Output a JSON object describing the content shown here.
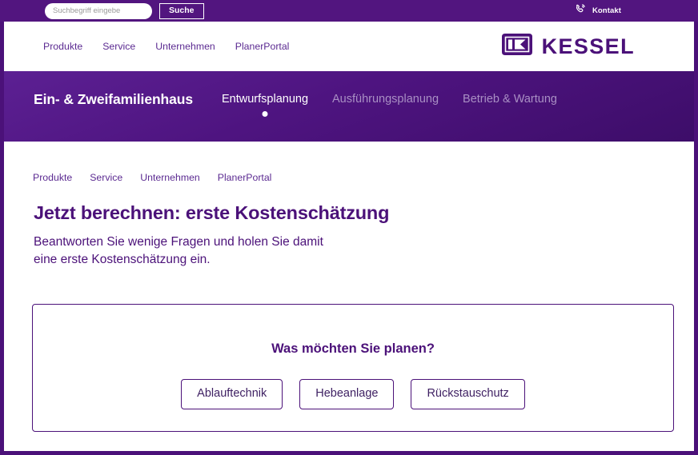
{
  "colors": {
    "brand_purple": "#4b1179",
    "utility_bar": "#52157f",
    "link_purple": "#5b2a91",
    "inactive_tab": "#a98fc4",
    "white": "#ffffff"
  },
  "utility_bar": {
    "search": {
      "placeholder": "Suchbegriff eingebe",
      "value": "",
      "button_label": "Suche"
    },
    "contact": {
      "label": "Kontakt",
      "icon": "phone-contact-icon"
    }
  },
  "main_nav": {
    "links": [
      {
        "label": "Produkte"
      },
      {
        "label": "Service"
      },
      {
        "label": "Unternehmen"
      },
      {
        "label": "PlanerPortal"
      }
    ],
    "logo": {
      "icon": "kessel-logo-mark-icon",
      "text": "KESSEL"
    }
  },
  "hero": {
    "title": "Ein- & Zweifamilienhaus",
    "tabs": [
      {
        "label": "Entwurfsplanung",
        "active": true
      },
      {
        "label": "Ausführungsplanung",
        "active": false
      },
      {
        "label": "Betrieb & Wartung",
        "active": false
      }
    ]
  },
  "breadcrumb": {
    "items": [
      {
        "label": "Produkte"
      },
      {
        "label": "Service"
      },
      {
        "label": "Unternehmen"
      },
      {
        "label": "PlanerPortal"
      }
    ]
  },
  "main": {
    "title": "Jetzt berechnen: erste Kostenschätzung",
    "subtitle_line1": "Beantworten Sie wenige Fragen und holen Sie damit",
    "subtitle_line2": "eine erste Kostenschätzung ein.",
    "question_panel": {
      "question": "Was möchten Sie planen?",
      "options": [
        {
          "label": "Ablauftechnik"
        },
        {
          "label": "Hebeanlage"
        },
        {
          "label": "Rückstauschutz"
        }
      ]
    }
  }
}
